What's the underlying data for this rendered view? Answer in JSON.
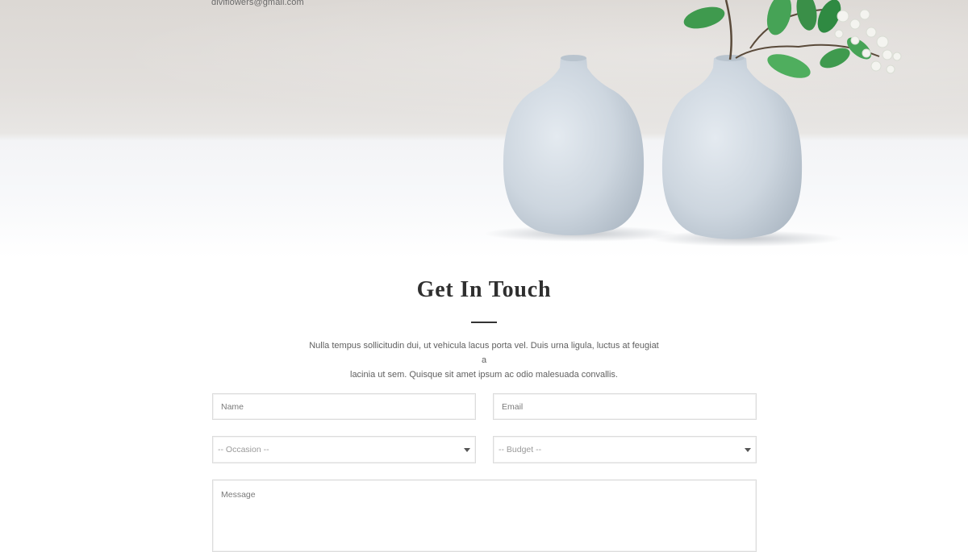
{
  "header": {
    "email": "diviflowers@gmail.com"
  },
  "hero": {
    "image": "two-white-vases-with-green-branch",
    "colors": {
      "wall": "#dcd8d4",
      "table": "#f5f6f8",
      "vase": "#c9d3dc",
      "leaf": "#3f9a4e"
    }
  },
  "contact": {
    "title": "Get In Touch",
    "intro_line1": "Nulla tempus sollicitudin dui, ut vehicula lacus porta vel. Duis urna ligula, luctus at feugiat a",
    "intro_line2": "lacinia ut sem. Quisque sit amet ipsum ac odio malesuada convallis.",
    "form": {
      "name_placeholder": "Name",
      "email_placeholder": "Email",
      "occasion_selected": "-- Occasion --",
      "budget_selected": "-- Budget --",
      "message_placeholder": "Message"
    }
  }
}
